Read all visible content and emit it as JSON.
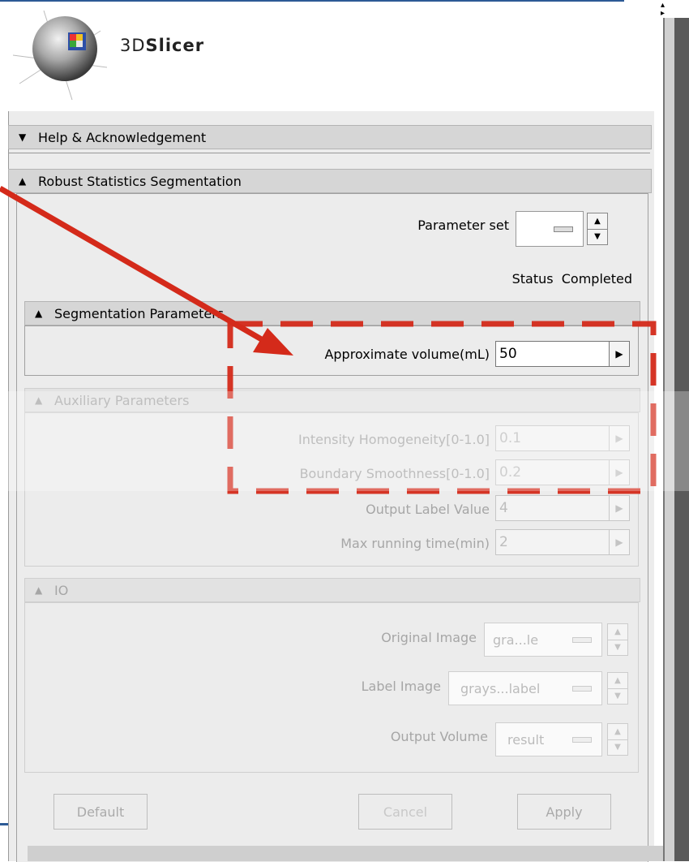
{
  "app": {
    "logo_prefix": "3D",
    "logo_suffix": "Slicer"
  },
  "sections": {
    "help": {
      "label": "Help & Acknowledgement",
      "expanded": false
    },
    "robust": {
      "label": "Robust Statistics Segmentation",
      "expanded": true
    },
    "segmentation_params": {
      "label": "Segmentation Parameters"
    },
    "auxiliary_params": {
      "label": "Auxiliary Parameters"
    },
    "io": {
      "label": "IO"
    }
  },
  "parameter_set": {
    "label": "Parameter set"
  },
  "status": {
    "label": "Status",
    "value": "Completed"
  },
  "approx_volume": {
    "label": "Approximate volume(mL)",
    "value": "50"
  },
  "auxiliary": [
    {
      "label": "Intensity Homogeneity[0-1.0]",
      "value": "0.1"
    },
    {
      "label": "Boundary Smoothness[0-1.0]",
      "value": "0.2"
    },
    {
      "label": "Output Label Value",
      "value": "4"
    },
    {
      "label": "Max running time(min)",
      "value": "2"
    }
  ],
  "io_fields": {
    "original_image": {
      "label": "Original Image",
      "value": "gra...le"
    },
    "label_image": {
      "label": "Label Image",
      "value": "grays...label"
    },
    "output_volume": {
      "label": "Output Volume",
      "value": "result"
    }
  },
  "buttons": {
    "default": "Default",
    "cancel": "Cancel",
    "apply": "Apply"
  },
  "colors": {
    "annotation_red": "#d42a1a",
    "accent_blue": "#2c5a95"
  }
}
